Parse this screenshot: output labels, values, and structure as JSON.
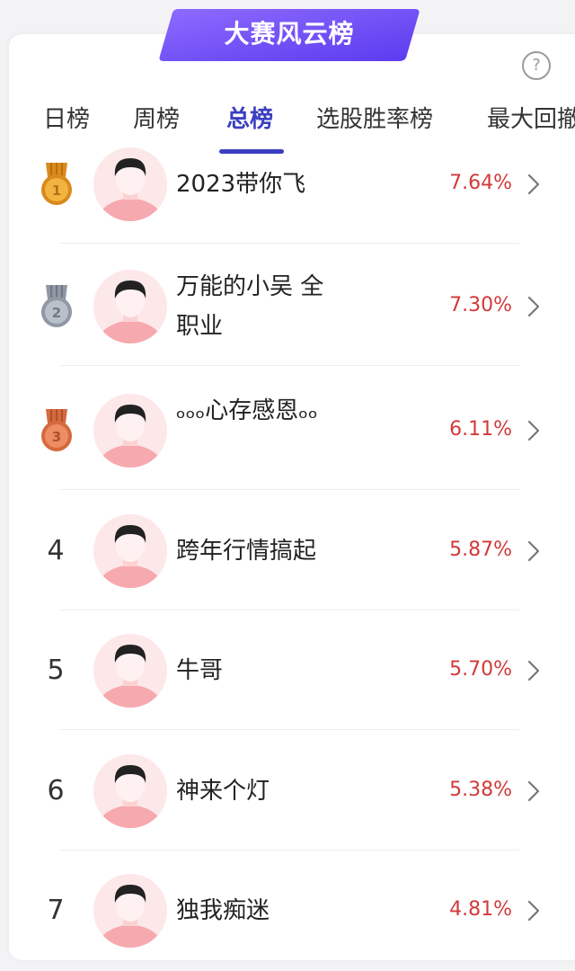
{
  "banner": {
    "title": "大赛风云榜",
    "color_start": "#8a63ff",
    "color_end": "#5b3bf0"
  },
  "help": {
    "icon": "question-circle-icon",
    "glyph": "?"
  },
  "tabs": [
    {
      "label": "日榜",
      "active": false
    },
    {
      "label": "周榜",
      "active": false
    },
    {
      "label": "总榜",
      "active": true
    },
    {
      "label": "选股胜率榜",
      "active": false
    },
    {
      "label": "最大回撤",
      "active": false
    }
  ],
  "colors": {
    "accent": "#3b3fc0",
    "rate_red": "#d23a3a",
    "gold": "#e8a33a",
    "silver": "#9aa3ad",
    "bronze": "#e07a4e"
  },
  "rankings": [
    {
      "rank": "1",
      "medal": "gold-medal-icon",
      "name": "2023带你飞",
      "rate": "7.64%"
    },
    {
      "rank": "2",
      "medal": "silver-medal-icon",
      "name": "万能的小吴 全职业",
      "rate": "7.30%"
    },
    {
      "rank": "3",
      "medal": "bronze-medal-icon",
      "name": "ₒₒₒ心存感恩ₒₒ",
      "rate": "6.11%"
    },
    {
      "rank": "4",
      "medal": null,
      "name": "跨年行情搞起",
      "rate": "5.87%"
    },
    {
      "rank": "5",
      "medal": null,
      "name": "牛哥",
      "rate": "5.70%"
    },
    {
      "rank": "6",
      "medal": null,
      "name": "神来个灯",
      "rate": "5.38%"
    },
    {
      "rank": "7",
      "medal": null,
      "name": "独我痴迷",
      "rate": "4.81%"
    }
  ]
}
